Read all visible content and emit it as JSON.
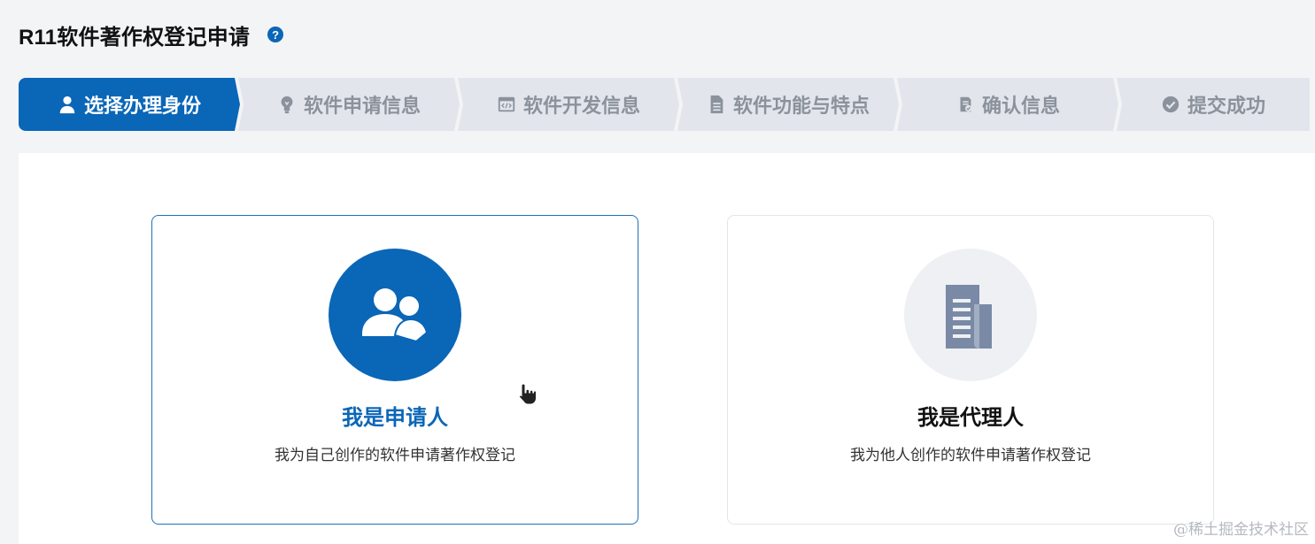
{
  "header": {
    "title": "R11软件著作权登记申请",
    "help_icon": "question-circle-icon",
    "help_glyph": "?"
  },
  "steps": [
    {
      "label": "选择办理身份",
      "icon": "user-icon",
      "active": true
    },
    {
      "label": "软件申请信息",
      "icon": "lightbulb-icon",
      "active": false
    },
    {
      "label": "软件开发信息",
      "icon": "code-window-icon",
      "active": false
    },
    {
      "label": "软件功能与特点",
      "icon": "document-icon",
      "active": false
    },
    {
      "label": "确认信息",
      "icon": "clipboard-check-icon",
      "active": false
    },
    {
      "label": "提交成功",
      "icon": "check-circle-icon",
      "active": false
    }
  ],
  "cards": {
    "applicant": {
      "title": "我是申请人",
      "description": "我为自己创作的软件申请著作权登记",
      "icon": "users-icon",
      "selected": true
    },
    "agent": {
      "title": "我是代理人",
      "description": "我为他人创作的软件申请著作权登记",
      "icon": "documents-icon",
      "selected": false
    }
  },
  "watermark": "@稀土掘金技术社区",
  "colors": {
    "primary": "#0a66b7",
    "inactive_step_bg": "#e2e6ec",
    "inactive_step_text": "#8c929c",
    "agent_icon": "#7a8aa6"
  }
}
